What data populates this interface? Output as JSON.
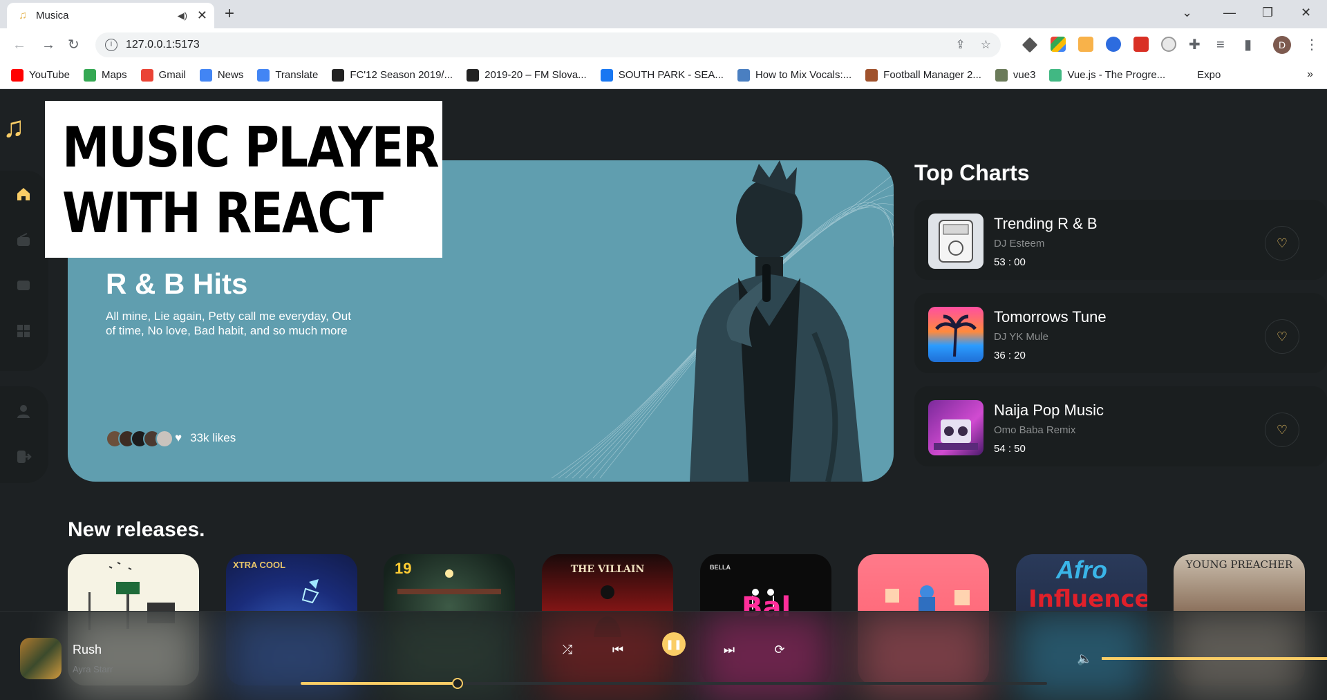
{
  "browser": {
    "tab_title": "Musica",
    "url": "127.0.0.1:5173",
    "profile_initial": "D",
    "bookmarks": [
      {
        "label": "YouTube",
        "color": "#ff0000"
      },
      {
        "label": "Maps",
        "color": "#34a853"
      },
      {
        "label": "Gmail",
        "color": "#ea4335"
      },
      {
        "label": "News",
        "color": "#4285f4"
      },
      {
        "label": "Translate",
        "color": "#4285f4"
      },
      {
        "label": "FC'12 Season 2019/...",
        "color": "#222222"
      },
      {
        "label": "2019-20 – FM Slova...",
        "color": "#222222"
      },
      {
        "label": "SOUTH PARK - SEA...",
        "color": "#1877f2"
      },
      {
        "label": "How to Mix Vocals:...",
        "color": "#4a7fc1"
      },
      {
        "label": "Football Manager 2...",
        "color": "#a0522d"
      },
      {
        "label": "vue3",
        "color": "#6b7b5a"
      },
      {
        "label": "Vue.js - The Progre...",
        "color": "#41b883"
      },
      {
        "label": "Expo",
        "color": "#ffffff"
      }
    ]
  },
  "overlay": {
    "line1": "MUSIC PLAYER",
    "line2": "WITH REACT"
  },
  "hero": {
    "title": "R & B Hits",
    "description": "All mine, Lie again, Petty call me everyday, Out of time, No love, Bad habit, and so much more",
    "likes": "33k likes"
  },
  "top_charts": {
    "title": "Top Charts",
    "items": [
      {
        "name": "Trending R & B",
        "artist": "DJ Esteem",
        "duration": "53 : 00"
      },
      {
        "name": "Tomorrows Tune",
        "artist": "DJ YK Mule",
        "duration": "36 : 20"
      },
      {
        "name": "Naija Pop Music",
        "artist": "Omo Baba Remix",
        "duration": "54 : 50"
      }
    ]
  },
  "new_releases": {
    "title": "New releases.",
    "covers": [
      {
        "text": ""
      },
      {
        "text": "XTRA COOL"
      },
      {
        "text": "19"
      },
      {
        "text": "THE VILLAIN"
      },
      {
        "text": "BELLA"
      },
      {
        "text": ""
      },
      {
        "text": "Afro"
      },
      {
        "text": "YOUNG PREACHER"
      }
    ]
  },
  "player": {
    "track_title": "Rush",
    "track_artist": "Ayra Starr",
    "progress": 0.21,
    "volume": 1.0
  },
  "colors": {
    "accent": "#facd66",
    "background": "#1d2123",
    "hero": "#609eaf"
  }
}
